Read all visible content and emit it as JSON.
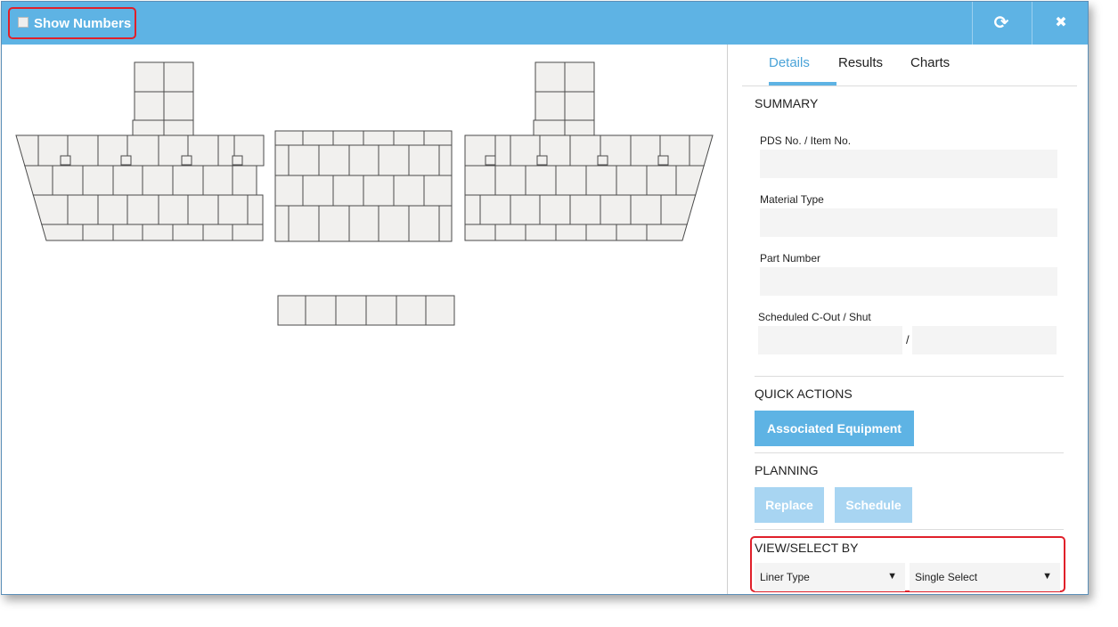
{
  "toolbar": {
    "show_numbers_label": "Show Numbers",
    "show_numbers_checked": false,
    "refresh_glyph": "⟳",
    "close_glyph": "✖",
    "icons": {
      "refresh": "refresh-icon",
      "close": "close-icon"
    }
  },
  "tabs": [
    {
      "label": "Details",
      "active": true
    },
    {
      "label": "Results",
      "active": false
    },
    {
      "label": "Charts",
      "active": false
    }
  ],
  "summary": {
    "title": "SUMMARY",
    "pds_label": "PDS No. / Item No.",
    "pds_value": "",
    "material_label": "Material Type",
    "material_value": "",
    "part_label": "Part Number",
    "part_value": "",
    "scheduled_label": "Scheduled C-Out / Shut",
    "scheduled_cout": "",
    "scheduled_shut": "",
    "separator": "/"
  },
  "quick_actions": {
    "title": "QUICK ACTIONS",
    "associated_equipment": "Associated Equipment"
  },
  "planning": {
    "title": "PLANNING",
    "replace": "Replace",
    "schedule": "Schedule"
  },
  "view_select": {
    "title": "VIEW/SELECT BY",
    "view_by": "Liner Type",
    "select_mode": "Single Select",
    "arrow": "▼"
  },
  "colors": {
    "titlebar": "#5eb3e4",
    "accent": "#5eb3e4",
    "highlight": "#e0202a",
    "tile": "#f1f0ee"
  }
}
